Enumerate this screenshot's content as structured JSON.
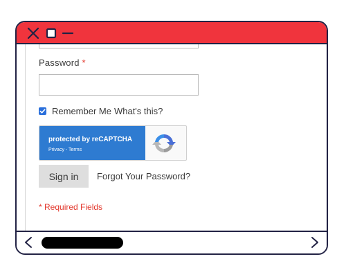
{
  "titlebar": {
    "background": "#f0343d",
    "close_icon": "close-icon",
    "maximize_icon": "maximize-icon",
    "minimize_icon": "minimize-icon"
  },
  "form": {
    "password_label": "Password",
    "required_marker": "*",
    "password_value": "",
    "remember_checked": true,
    "remember_label": "Remember Me",
    "whats_this": "What's this?",
    "recaptcha": {
      "protected_text": "protected by reCAPTCHA",
      "links_text": "Privacy - Terms",
      "logo_icon": "recaptcha-logo-icon"
    },
    "signin_label": "Sign in",
    "forgot_label": "Forgot Your Password?",
    "required_fields": "* Required Fields"
  },
  "scrollbar": {
    "left_icon": "chevron-left-icon",
    "right_icon": "chevron-right-icon"
  },
  "colors": {
    "accent_red": "#e33a2f",
    "recaptcha_blue": "#2e7bd1",
    "checkbox_blue": "#2a6fdb"
  }
}
